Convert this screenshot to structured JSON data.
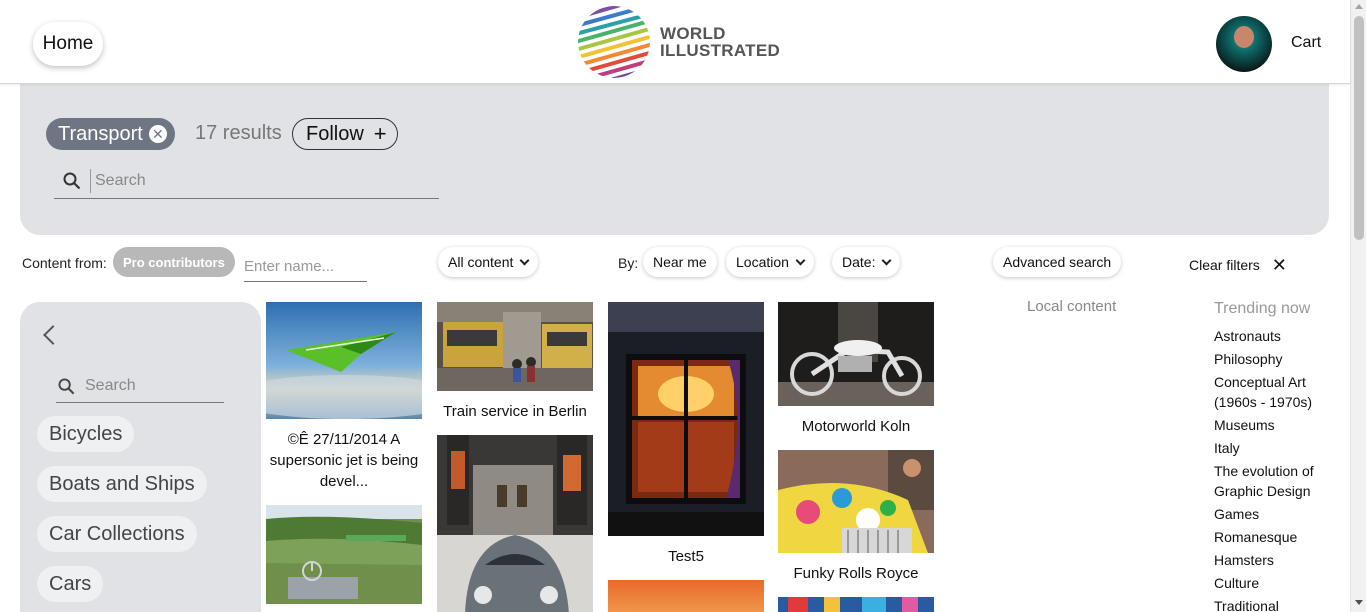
{
  "header": {
    "home_label": "Home",
    "logo_line1": "WORLD",
    "logo_line2": "ILLUSTRATED",
    "cart_label": "Cart"
  },
  "search_panel": {
    "tag": "Transport",
    "results": "17 results",
    "follow_label": "Follow",
    "follow_icon": "+",
    "search_placeholder": "Search"
  },
  "filters": {
    "content_from_label": "Content from:",
    "pro_contributors": "Pro contributors",
    "name_placeholder": "Enter name...",
    "all_content": "All content",
    "by_label": "By:",
    "near_me": "Near me",
    "location": "Location",
    "date": "Date:",
    "advanced_search": "Advanced search",
    "clear_filters": "Clear filters"
  },
  "sidebar": {
    "search_placeholder": "Search",
    "categories": [
      "Bicycles",
      "Boats and Ships",
      "Car Collections",
      "Cars"
    ]
  },
  "gallery": [
    {
      "caption": "©Ê 27/11/2014 A supersonic jet is being devel..."
    },
    {
      "caption": ""
    },
    {
      "caption": "Train service in Berlin"
    },
    {
      "caption": ""
    },
    {
      "caption": "Test5"
    },
    {
      "caption": ""
    },
    {
      "caption": "Motorworld Koln"
    },
    {
      "caption": "Funky Rolls Royce"
    },
    {
      "caption": ""
    }
  ],
  "local_content": "Local content",
  "trending": {
    "title": "Trending now",
    "items": [
      "Astronauts",
      "Philosophy",
      "Conceptual Art (1960s - 1970s)",
      "Museums",
      "Italy",
      "The evolution of Graphic Design",
      "Games",
      "Romanesque",
      "Hamsters",
      "Culture",
      "Traditional"
    ]
  },
  "colors": {
    "panel_bg": "#e0e2e6",
    "tag_bg": "#6e7683",
    "pro_pill_bg": "#b8b8b8"
  }
}
